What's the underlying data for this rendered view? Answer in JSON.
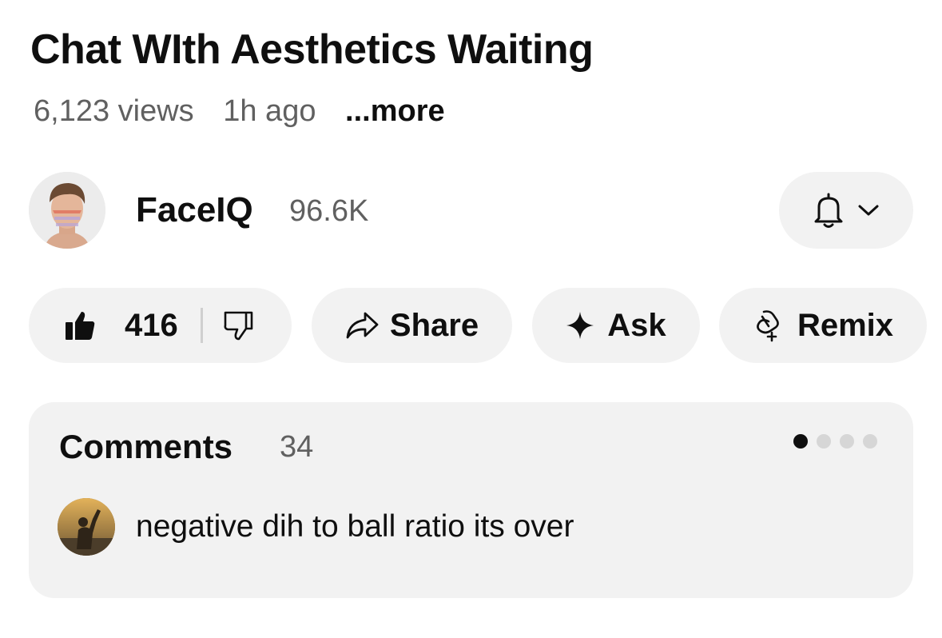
{
  "video": {
    "title": "Chat WIth Aesthetics Waiting",
    "views": "6,123 views",
    "posted": "1h ago",
    "more_label": "...more"
  },
  "channel": {
    "name": "FaceIQ",
    "subscribers": "96.6K",
    "avatar_icon": "channel-avatar",
    "bell_icon": "bell-icon",
    "chevron_icon": "chevron-down-icon"
  },
  "actions": {
    "likes": "416",
    "share_label": "Share",
    "ask_label": "Ask",
    "remix_label": "Remix"
  },
  "comments": {
    "title": "Comments",
    "count": "34",
    "carousel_pages": 4,
    "carousel_active": 0,
    "preview": {
      "text": "negative dih to ball ratio its over"
    }
  },
  "colors": {
    "background": "#ffffff",
    "pill": "#f2f2f2",
    "text_primary": "#0f0f0f",
    "text_secondary": "#606060"
  }
}
